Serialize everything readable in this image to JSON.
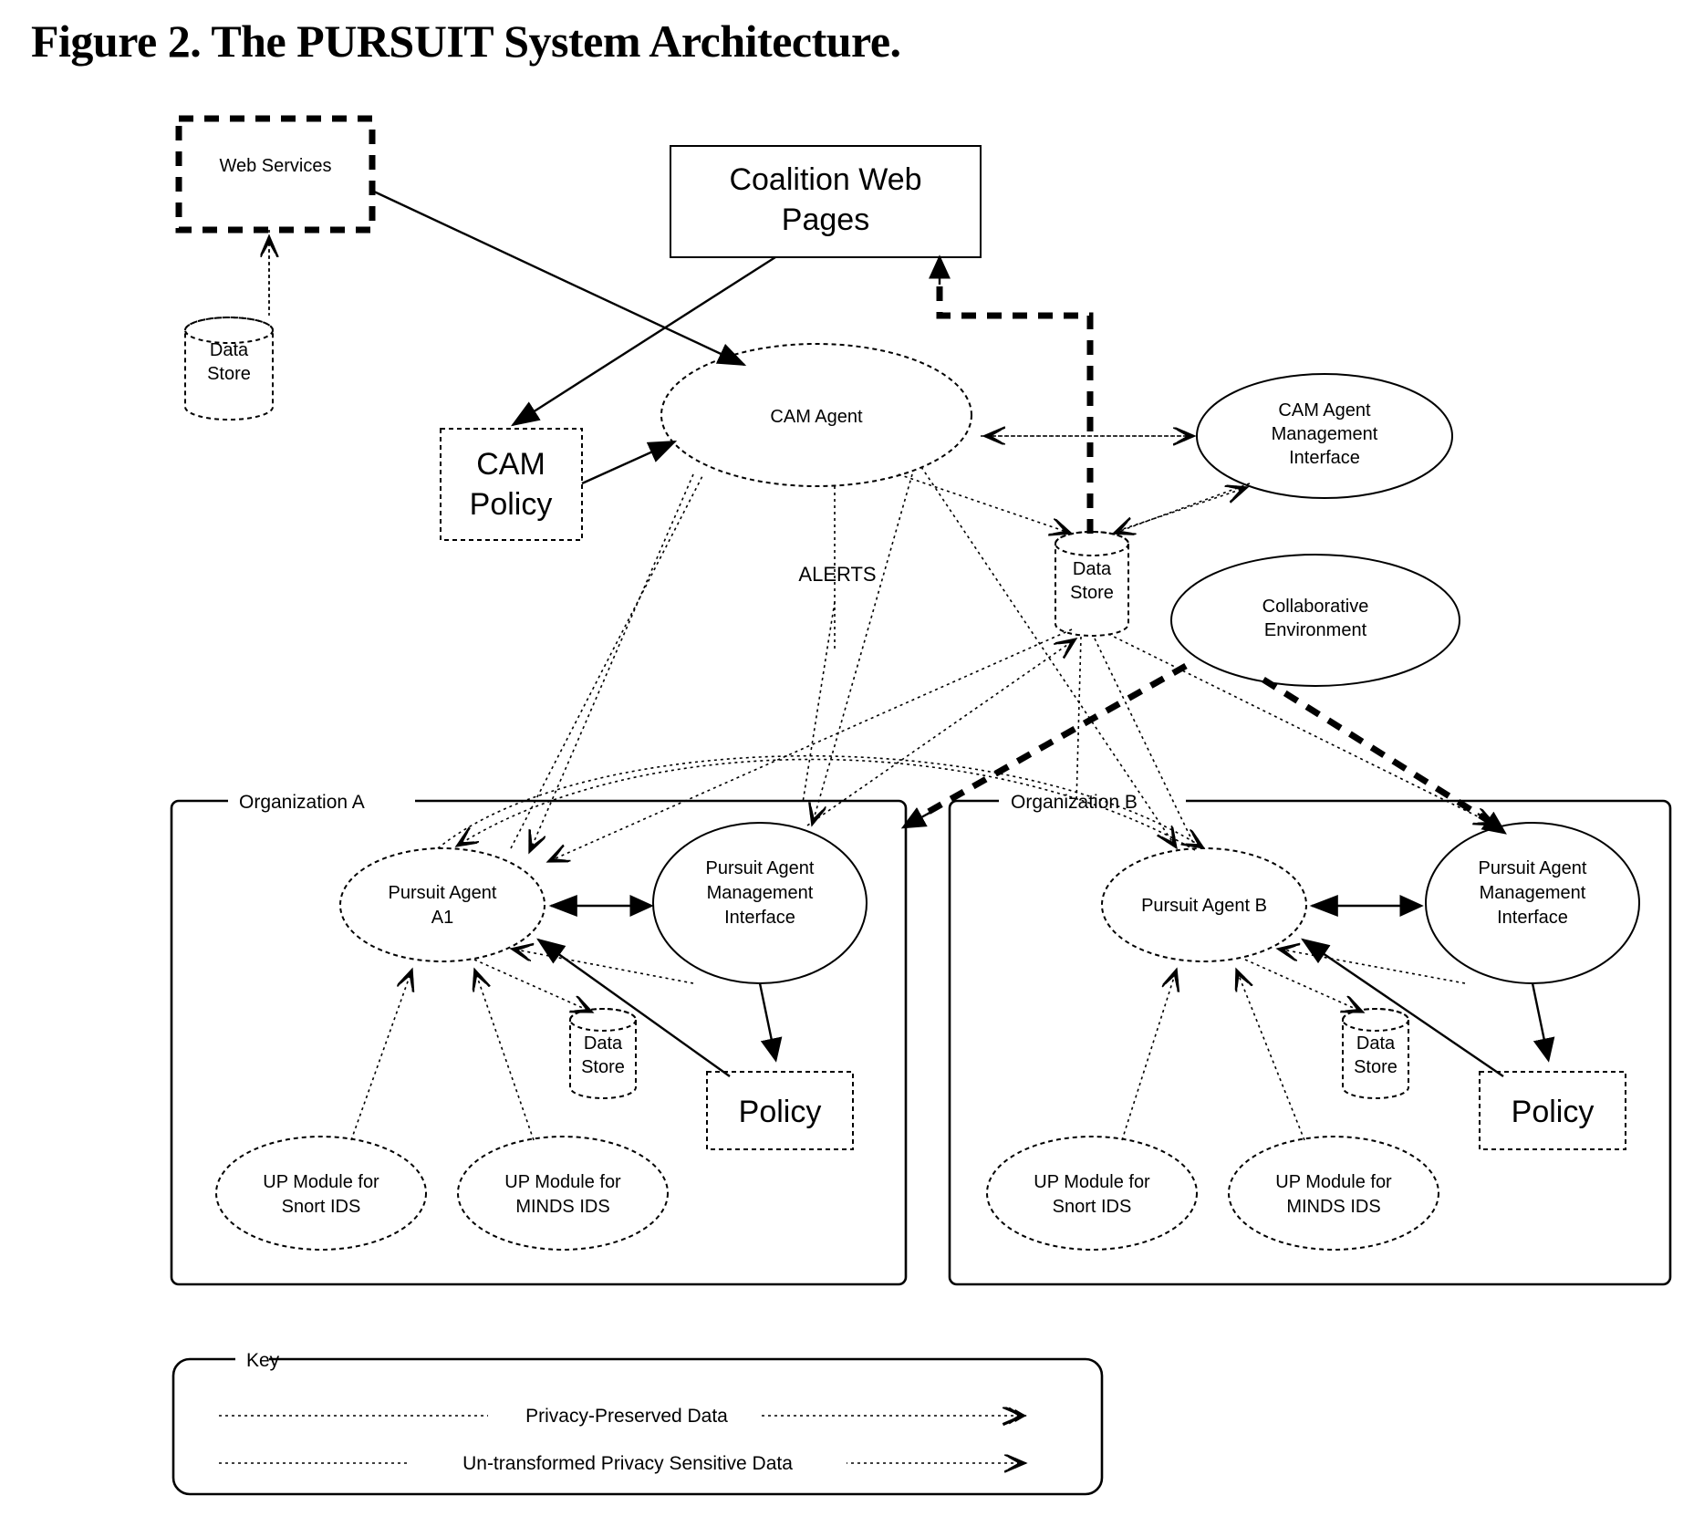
{
  "figure": {
    "title": "Figure 2. The PURSUIT System Architecture."
  },
  "nodes": {
    "web_services": "Web Services",
    "web_data_store": "Data\nStore",
    "web_data_store_l1": "Data",
    "web_data_store_l2": "Store",
    "coalition_web_pages_l1": "Coalition Web",
    "coalition_web_pages_l2": "Pages",
    "cam_agent": "CAM Agent",
    "cam_policy_l1": "CAM",
    "cam_policy_l2": "Policy",
    "cam_mgmt_l1": "CAM Agent",
    "cam_mgmt_l2": "Management",
    "cam_mgmt_l3": "Interface",
    "center_data_store_l1": "Data",
    "center_data_store_l2": "Store",
    "collaborative_env_l1": "Collaborative",
    "collaborative_env_l2": "Environment",
    "alerts_label": "ALERTS",
    "org_a": "Organization A",
    "org_b": "Organization B",
    "pursuit_agent_a_l1": "Pursuit Agent",
    "pursuit_agent_a_l2": "A1",
    "pursuit_agent_b": "Pursuit Agent B",
    "pa_mgmt_l1": "Pursuit Agent",
    "pa_mgmt_l2": "Management",
    "pa_mgmt_l3": "Interface",
    "policy": "Policy",
    "org_data_store_l1": "Data",
    "org_data_store_l2": "Store",
    "up_snort_l1": "UP Module for",
    "up_snort_l2": "Snort IDS",
    "up_minds_l1": "UP Module for",
    "up_minds_l2": "MINDS IDS"
  },
  "key": {
    "title": "Key",
    "privacy_preserved": "Privacy-Preserved Data",
    "untransformed": "Un-transformed Privacy Sensitive Data"
  },
  "colors": {
    "ink": "#000000",
    "paper": "#ffffff"
  }
}
